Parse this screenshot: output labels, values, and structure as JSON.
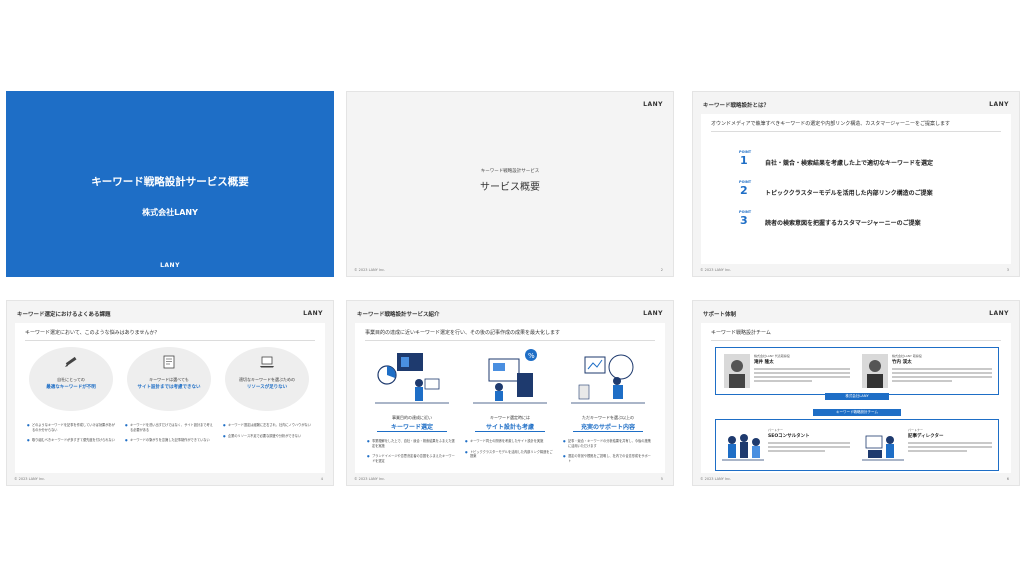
{
  "slide1": {
    "title": "キーワード戦略設計サービス概要",
    "company": "株式会社LANY",
    "logo": "LANY",
    "bg_color": "#1e6ec6"
  },
  "slide2": {
    "logo": "LANY",
    "section_small": "キーワード戦略設計サービス",
    "section_big": "サービス概要",
    "copyright": "© 2023 LANY Inc.",
    "page": "2"
  },
  "slide3": {
    "title": "キーワード戦略設計とは？",
    "logo": "LANY",
    "subhead": "オウンドメディアで執筆すべきキーワードの選定や内部リンク構造、カスタマージャーニーをご提案します",
    "points": [
      {
        "label": "POINT",
        "num": "1",
        "text": "自社・競合・検索結果を考慮した上で適切なキーワードを選定"
      },
      {
        "label": "POINT",
        "num": "2",
        "text": "トピッククラスターモデルを活用した内部リンク構造のご提案"
      },
      {
        "label": "POINT",
        "num": "3",
        "text": "読者の検索意図を把握するカスタマージャーニーのご提案"
      }
    ],
    "copyright": "© 2023 LANY Inc.",
    "page": "3"
  },
  "slide4": {
    "title": "キーワード選定におけるよくある課題",
    "logo": "LANY",
    "subhead": "キーワード選定において、このような悩みはありませんか？",
    "bubbles": [
      {
        "icon": "pencil-icon",
        "line1": "自社にとっての",
        "line2": "最適なキーワードが不明"
      },
      {
        "icon": "document-icon",
        "line1": "キーワードは選べても",
        "line2": "サイト設計までは考慮できない"
      },
      {
        "icon": "laptop-icon",
        "line1": "適切なキーワードを選ぶための",
        "line2": "リソースが足りない"
      }
    ],
    "lists": [
      [
        "どのようなキーワードを記事を作成していけば効果があがるのか分からない",
        "取り組むべきキーワードが多すぎて優先度を付けられない"
      ],
      [
        "キーワードを洗い出すだけではなく、サイト設計まで考える必要がある",
        "キーワードの繋がりを意識した記事制作ができていない"
      ],
      [
        "キーワード選定は経験に左右され、社内にノウハウがない",
        "企業のリソース不足で必要な調査や分析ができない"
      ]
    ],
    "copyright": "© 2023 LANY Inc.",
    "page": "4"
  },
  "slide5": {
    "title": "キーワード戦略設計サービス紹介",
    "logo": "LANY",
    "subhead": "事業目的の達成に近いキーワード選定を行い、その後の記事作成の成果を最大化します",
    "features": [
      {
        "small": "事業目的の達成に近い",
        "big": "キーワード選定",
        "bullets": [
          "事業理解をした上で、自社・競合・検索結果をふまえた選定を実施",
          "ブランドイメージや意思決定者の意図をふまえたキーワードを選定"
        ]
      },
      {
        "small": "キーワード選定時には",
        "big": "サイト設計も考慮",
        "bullets": [
          "キーワード同士の関係を考慮したサイト設計を実施",
          "トピッククラスターモデルを活用した内部リンク構造をご提案"
        ]
      },
      {
        "small": "ただキーワードを選ぶ以上の",
        "big": "充実のサポート内容",
        "bullets": [
          "記事・競合・キーワードの分析結果を共有し、今後の施策に活用いただけます",
          "選定の背景や根拠をご説明し、社内での合意形成をサポート"
        ]
      }
    ],
    "copyright": "© 2023 LANY Inc.",
    "page": "5"
  },
  "slide6": {
    "title": "サポート体制",
    "logo": "LANY",
    "subhead": "キーワード戦略設計チーム",
    "company_tag": "株式会社LANY",
    "team_tag": "キーワード戦略設計チーム",
    "top_people": [
      {
        "role": "株式会社LANY 代表取締役",
        "name": "滝井 隆太"
      },
      {
        "role": "株式会社LANY 取締役",
        "name": "竹内 渓太"
      }
    ],
    "bottom_people": [
      {
        "role": "パートナー",
        "name": "SEOコンサルタント"
      },
      {
        "role": "パートナー",
        "name": "記事ディレクター"
      }
    ],
    "copyright": "© 2023 LANY Inc.",
    "page": "6"
  }
}
